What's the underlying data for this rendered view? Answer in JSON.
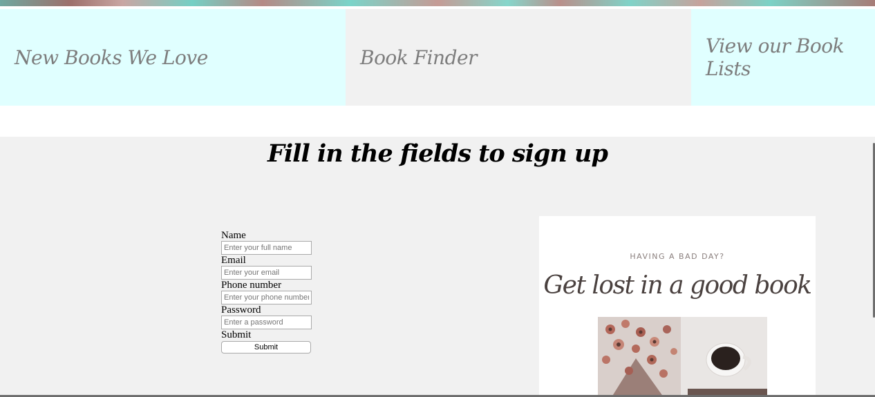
{
  "nav": {
    "tiles": [
      {
        "label": "New Books We Love"
      },
      {
        "label": "Book Finder"
      },
      {
        "label": "View our Book Lists"
      }
    ]
  },
  "signup": {
    "title": "Fill in the fields to sign up",
    "fields": [
      {
        "label": "Name",
        "placeholder": "Enter your full name"
      },
      {
        "label": "Email",
        "placeholder": "Enter your email"
      },
      {
        "label": "Phone number",
        "placeholder": "Enter your phone number"
      },
      {
        "label": "Password",
        "placeholder": "Enter a password"
      }
    ],
    "submit_label": "Submit",
    "submit_button": "Submit"
  },
  "promo": {
    "kicker": "HAVING A BAD DAY?",
    "headline": "Get lost in a good book"
  },
  "colors": {
    "nav_cyan": "#e0ffff",
    "nav_grey": "#f1f1f1",
    "nav_text": "#7d7d7d",
    "section_bg": "#f1f1f1",
    "promo_text": "#4a413f"
  }
}
